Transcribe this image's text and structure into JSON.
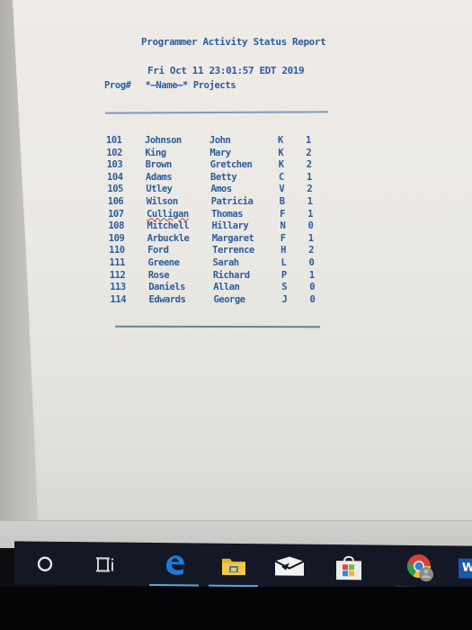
{
  "report": {
    "title": "Programmer Activity Status Report",
    "timestamp": "Fri Oct 11 23:01:57 EDT 2019",
    "column_header": "Prog#   *—Name—* Projects"
  },
  "rows": [
    {
      "prog": "101",
      "last": "Johnson",
      "first": "John",
      "code": "K",
      "projects": "1"
    },
    {
      "prog": "102",
      "last": "King",
      "first": "Mary",
      "code": "K",
      "projects": "2"
    },
    {
      "prog": "103",
      "last": "Brown",
      "first": "Gretchen",
      "code": "K",
      "projects": "2"
    },
    {
      "prog": "104",
      "last": "Adams",
      "first": "Betty",
      "code": "C",
      "projects": "1"
    },
    {
      "prog": "105",
      "last": "Utley",
      "first": "Amos",
      "code": "V",
      "projects": "2"
    },
    {
      "prog": "106",
      "last": "Wilson",
      "first": "Patricia",
      "code": "B",
      "projects": "1"
    },
    {
      "prog": "107",
      "last": "Culligan",
      "first": "Thomas",
      "code": "F",
      "projects": "1"
    },
    {
      "prog": "108",
      "last": "Mitchell",
      "first": "Hillary",
      "code": "N",
      "projects": "0"
    },
    {
      "prog": "109",
      "last": "Arbuckle",
      "first": "Margaret",
      "code": "F",
      "projects": "1"
    },
    {
      "prog": "110",
      "last": "Ford",
      "first": "Terrence",
      "code": "H",
      "projects": "2"
    },
    {
      "prog": "111",
      "last": "Greene",
      "first": "Sarah",
      "code": "L",
      "projects": "0"
    },
    {
      "prog": "112",
      "last": "Rose",
      "first": "Richard",
      "code": "P",
      "projects": "1"
    },
    {
      "prog": "113",
      "last": "Daniels",
      "first": "Allan",
      "code": "S",
      "projects": "0"
    },
    {
      "prog": "114",
      "last": "Edwards",
      "first": "George",
      "code": "J",
      "projects": "0"
    }
  ],
  "taskbar": {
    "items": [
      {
        "icon": "cortana-search-icon",
        "active": false
      },
      {
        "icon": "task-view-icon",
        "active": false
      },
      {
        "icon": "edge-browser-icon",
        "active": true
      },
      {
        "icon": "file-explorer-icon",
        "active": true
      },
      {
        "icon": "mail-icon",
        "active": false
      },
      {
        "icon": "microsoft-store-icon",
        "active": false
      },
      {
        "icon": "chrome-icon",
        "active": true
      },
      {
        "icon": "word-icon",
        "active": false
      }
    ],
    "word_label": "W"
  },
  "colors": {
    "text": "#2c5d9e",
    "taskbar": "#141824",
    "active_indicator": "#5aa6d8"
  }
}
